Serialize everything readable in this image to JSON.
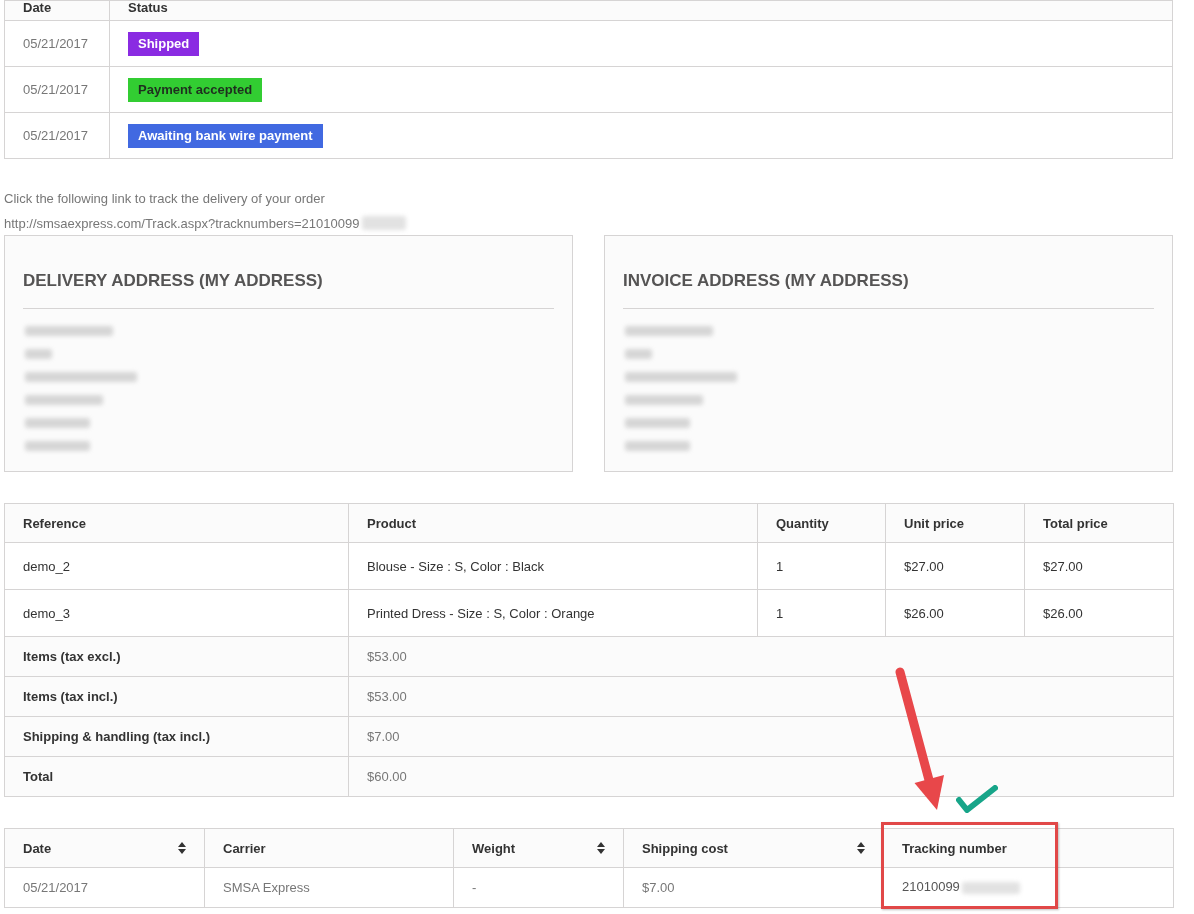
{
  "status_history": {
    "columns": [
      "Date",
      "Status"
    ],
    "rows": [
      {
        "date": "05/21/2017",
        "status": "Shipped",
        "color": "#8a2be2"
      },
      {
        "date": "05/21/2017",
        "status": "Payment accepted",
        "color": "#32cd32"
      },
      {
        "date": "05/21/2017",
        "status": "Awaiting bank wire payment",
        "color": "#4169e1"
      }
    ]
  },
  "tracking": {
    "instructions": "Click the following link to track the delivery of your order",
    "link": "http://smsaexpress.com/Track.aspx?tracknumbers=21010099",
    "masked": true
  },
  "addresses": [
    {
      "title": "DELIVERY ADDRESS (MY ADDRESS)",
      "lines": [
        {
          "kind": "redacted"
        },
        {
          "kind": "redacted"
        },
        {
          "kind": "redacted"
        },
        {
          "kind": "redacted"
        },
        {
          "kind": "redacted"
        },
        {
          "kind": "redacted"
        }
      ]
    },
    {
      "title": "INVOICE ADDRESS (MY ADDRESS)",
      "lines": [
        {
          "kind": "redacted"
        },
        {
          "kind": "redacted"
        },
        {
          "kind": "redacted"
        },
        {
          "kind": "redacted"
        },
        {
          "kind": "redacted"
        },
        {
          "kind": "redacted"
        }
      ]
    }
  ],
  "products": {
    "columns": [
      "Reference",
      "Product",
      "Quantity",
      "Unit price",
      "Total price"
    ],
    "rows": [
      [
        "demo_2",
        "Blouse - Size : S, Color : Black",
        "1",
        "$27.00",
        "$27.00"
      ],
      [
        "demo_3",
        "Printed Dress - Size : S, Color : Orange",
        "1",
        "$26.00",
        "$26.00"
      ]
    ],
    "totals": [
      {
        "label": "Items (tax excl.)",
        "value": "$53.00"
      },
      {
        "label": "Items (tax incl.)",
        "value": "$53.00"
      },
      {
        "label": "Shipping & handling (tax incl.)",
        "value": "$7.00"
      },
      {
        "label": "Total",
        "value": "$60.00"
      }
    ]
  },
  "shipping": {
    "columns": [
      {
        "label": "Date",
        "sortable": true
      },
      {
        "label": "Carrier",
        "sortable": false
      },
      {
        "label": "Weight",
        "sortable": true
      },
      {
        "label": "Shipping cost",
        "sortable": true
      },
      {
        "label": "Tracking number",
        "sortable": false
      }
    ],
    "rows": [
      {
        "cells": [
          "05/21/2017",
          "SMSA Express",
          "-",
          "$7.00",
          "21010099"
        ],
        "masked": true
      }
    ]
  },
  "annotations": [
    {
      "kind": "arrow"
    },
    {
      "kind": "check"
    },
    {
      "kind": "frame"
    }
  ]
}
